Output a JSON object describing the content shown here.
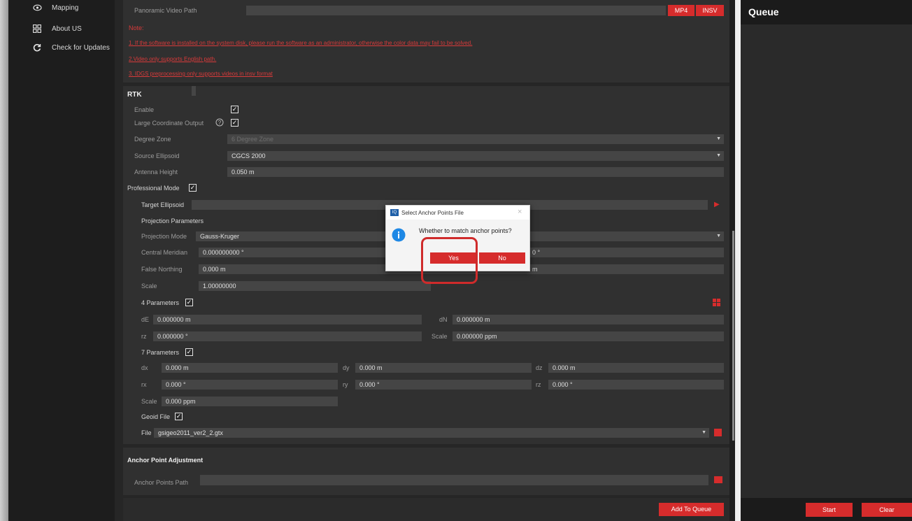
{
  "sidebar": {
    "items": [
      {
        "label": "Mapping",
        "icon": "mapping-icon"
      },
      {
        "label": "About US",
        "icon": "grid-icon"
      },
      {
        "label": "Check for Updates",
        "icon": "refresh-icon"
      }
    ]
  },
  "video": {
    "path_label": "Panoramic Video Path",
    "mp4_label": "MP4",
    "insv_label": "INSV"
  },
  "notes": {
    "title": "Note:",
    "line1": "1. If the software is installed on the system disk, please run the software as an administrator, otherwise the color data may fail to be solved.",
    "line2": "2.Video only supports English path.",
    "line3": "3. IDGS preprocessing only supports videos in insv format"
  },
  "rtk": {
    "title": "RTK",
    "enable_label": "Enable",
    "enable_checked": true,
    "large_coord_label": "Large Coordinate Output",
    "large_coord_checked": true,
    "degree_zone_label": "Degree Zone",
    "degree_zone_value": "6 Degree Zone",
    "source_ellipsoid_label": "Source Ellipsoid",
    "source_ellipsoid_value": "CGCS 2000",
    "antenna_height_label": "Antenna Height",
    "antenna_height_value": "0.050 m"
  },
  "professional": {
    "title": "Professional Mode",
    "checked": true,
    "target_ellipsoid_label": "Target Ellipsoid",
    "projection_parameters_label": "Projection Parameters",
    "projection_mode_label": "Projection Mode",
    "projection_mode_value": "Gauss-Kruger",
    "central_meridian_label": "Central Meridian",
    "central_meridian_value": "0.000000000 °",
    "false_northing_label": "False Northing",
    "false_northing_value": "0.000 m",
    "scale_label": "Scale",
    "scale_value": "1.00000000",
    "right_partial_1": "0 °",
    "right_partial_2": "m",
    "four_params_label": "4 Parameters",
    "four_params_checked": true,
    "de_label": "dE",
    "de_value": "0.000000 m",
    "dn_label": "dN",
    "dn_value": "0.000000 m",
    "rz_label": "rz",
    "rz_value": "0.000000 °",
    "scale4_label": "Scale",
    "scale4_value": "0.000000 ppm",
    "seven_params_label": "7 Parameters",
    "seven_params_checked": true,
    "dx_label": "dx",
    "dx_value": "0.000 m",
    "dy_label": "dy",
    "dy_value": "0.000 m",
    "dz_label": "dz",
    "dz_value": "0.000 m",
    "rx_label": "rx",
    "rx_value": "0.000 °",
    "ry_label": "ry",
    "ry_value": "0.000 °",
    "rz7_label": "rz",
    "rz7_value": "0.000 °",
    "scale7_label": "Scale",
    "scale7_value": "0.000 ppm",
    "geoid_label": "Geoid File",
    "geoid_checked": true,
    "file_label": "File",
    "file_value": "gsigeo2011_ver2_2.gtx"
  },
  "anchor": {
    "title": "Anchor Point Adjustment",
    "path_label": "Anchor Points Path"
  },
  "actions": {
    "add_to_queue": "Add To Queue"
  },
  "queue": {
    "title": "Queue",
    "start_label": "Start",
    "clear_label": "Clear"
  },
  "dialog": {
    "title": "Select Anchor Points File",
    "message": "Whether to match anchor points?",
    "yes_label": "Yes",
    "no_label": "No",
    "close_glyph": "×",
    "app_icon_text": "IQ"
  },
  "colors": {
    "accent_red": "#d62c2c",
    "note_red": "#d83a3a",
    "info_blue": "#1e88e5",
    "highlight_red": "#cf2b2b"
  }
}
